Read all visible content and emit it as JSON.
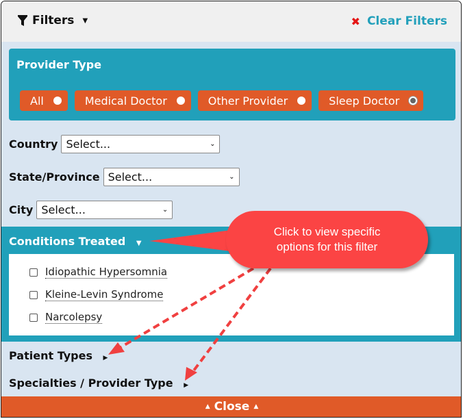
{
  "header": {
    "title": "Filters",
    "filter_icon": "funnel-icon",
    "clear_label": "Clear Filters",
    "clear_icon": "x-icon"
  },
  "provider_type": {
    "title": "Provider Type",
    "options": [
      {
        "label": "All",
        "selected": false
      },
      {
        "label": "Medical Doctor",
        "selected": false
      },
      {
        "label": "Other Provider",
        "selected": false
      },
      {
        "label": "Sleep Doctor",
        "selected": true
      }
    ]
  },
  "location": {
    "country": {
      "label": "Country",
      "value": "Select..."
    },
    "state": {
      "label": "State/Province",
      "value": "Select..."
    },
    "city": {
      "label": "City",
      "value": "Select..."
    }
  },
  "conditions": {
    "title": "Conditions Treated",
    "options": [
      {
        "label": "Idiopathic Hypersomnia",
        "checked": false
      },
      {
        "label": "Kleine-Levin Syndrome",
        "checked": false
      },
      {
        "label": "Narcolepsy",
        "checked": false
      }
    ]
  },
  "sections": {
    "patient_types": "Patient Types",
    "specialties": "Specialties / Provider Type"
  },
  "close_label": "Close",
  "callout": {
    "line1": "Click to view specific",
    "line2": "options for this filter"
  },
  "colors": {
    "accent_teal": "#21a0ba",
    "accent_orange": "#e05a28",
    "callout_red": "#fb4444",
    "clear_x_red": "#e41515"
  }
}
